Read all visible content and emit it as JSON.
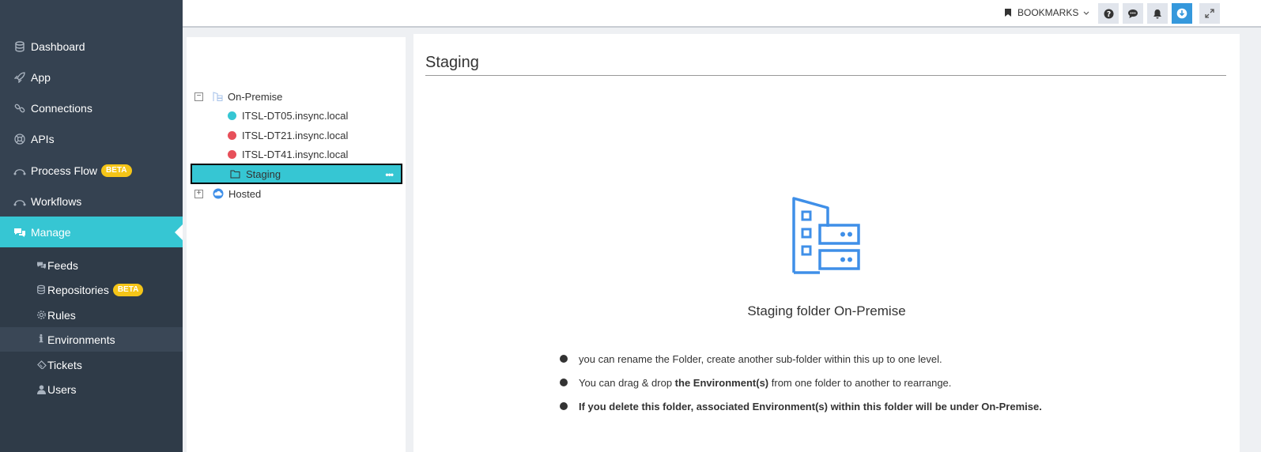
{
  "sidebar": {
    "items": [
      {
        "label": "Dashboard",
        "icon": "database-icon"
      },
      {
        "label": "App",
        "icon": "rocket-icon"
      },
      {
        "label": "Connections",
        "icon": "link-icon"
      },
      {
        "label": "APIs",
        "icon": "lifebuoy-icon"
      },
      {
        "label": "Process Flow",
        "icon": "flow-icon",
        "badge": "BETA"
      },
      {
        "label": "Workflows",
        "icon": "flow-icon"
      },
      {
        "label": "Manage",
        "icon": "comments-icon"
      }
    ],
    "sub_items": [
      {
        "label": "Feeds",
        "icon": "comments-icon"
      },
      {
        "label": "Repositories",
        "icon": "database-icon",
        "badge": "BETA"
      },
      {
        "label": "Rules",
        "icon": "gear-icon"
      },
      {
        "label": "Environments",
        "icon": "info-icon"
      },
      {
        "label": "Tickets",
        "icon": "ticket-icon"
      },
      {
        "label": "Users",
        "icon": "user-icon"
      }
    ]
  },
  "topbar": {
    "bookmarks_label": "BOOKMARKS"
  },
  "tree": {
    "on_premise": "On-Premise",
    "environments": [
      {
        "label": "ITSL-DT05.insync.local",
        "status_color": "#36c6d3"
      },
      {
        "label": "ITSL-DT21.insync.local",
        "status_color": "#e7505a"
      },
      {
        "label": "ITSL-DT41.insync.local",
        "status_color": "#e7505a"
      }
    ],
    "selected_folder": "Staging",
    "hosted": "Hosted"
  },
  "main": {
    "title": "Staging",
    "subtitle": "Staging folder On-Premise",
    "bullets": [
      {
        "pre": "you can rename the Folder, create another sub-folder within this up to one level.",
        "bold": "",
        "post": ""
      },
      {
        "pre": "You can drag & drop ",
        "bold": "the Environment(s)",
        "post": " from one folder to another to rearrange."
      },
      {
        "pre": "",
        "bold": "If you delete this folder, associated Environment(s) within this folder will be under On-Premise.",
        "post": ""
      }
    ]
  },
  "colors": {
    "sidebar_bg": "#354251",
    "accent": "#36c6d3",
    "badge": "#f5c518",
    "error": "#e7505a",
    "icon_blue": "#3f8fe8"
  }
}
